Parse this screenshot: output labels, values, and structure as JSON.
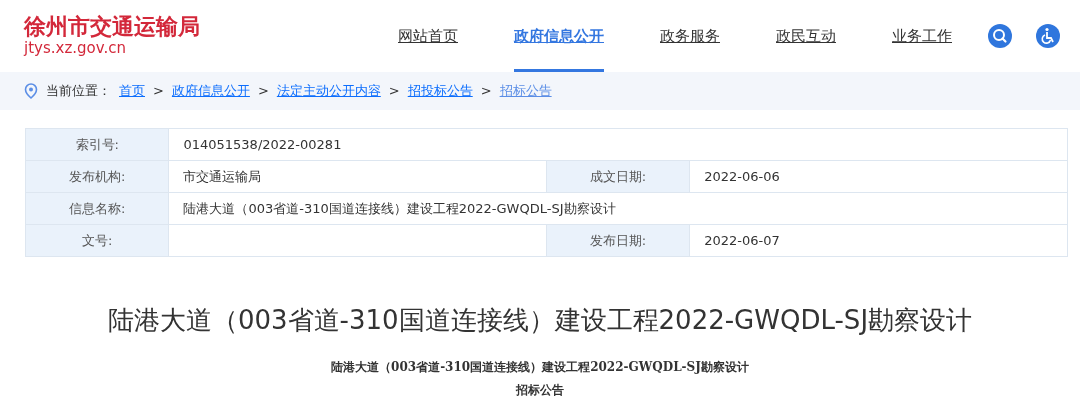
{
  "site": {
    "name": "徐州市交通运输局",
    "domain": "jtys.xz.gov.cn"
  },
  "nav": [
    {
      "label": "网站首页",
      "selected": false
    },
    {
      "label": "政府信息公开",
      "selected": true
    },
    {
      "label": "政务服务",
      "selected": false
    },
    {
      "label": "政民互动",
      "selected": false
    },
    {
      "label": "业务工作",
      "selected": false
    }
  ],
  "breadcrumb": {
    "label": "当前位置：",
    "items": [
      {
        "text": "首页",
        "current": false
      },
      {
        "text": "政府信息公开",
        "current": false
      },
      {
        "text": "法定主动公开内容",
        "current": false
      },
      {
        "text": "招投标公告",
        "current": false
      },
      {
        "text": "招标公告",
        "current": true
      }
    ],
    "separators": [
      ">",
      ">",
      ">",
      ">"
    ]
  },
  "info_table": {
    "rows": [
      {
        "cells": [
          {
            "label": "索引号:",
            "value": "014051538/2022-00281"
          }
        ]
      },
      {
        "cells": [
          {
            "label": "发布机构:",
            "value": "市交通运输局"
          },
          {
            "label": "成文日期:",
            "value": "2022-06-06"
          }
        ]
      },
      {
        "cells": [
          {
            "label": "信息名称:",
            "value": "陆港大道（003省道-310国道连接线）建设工程2022-GWQDL-SJ勘察设计"
          }
        ]
      },
      {
        "cells": [
          {
            "label": "文号:"
          },
          {
            "label": "发布日期:",
            "value": "2022-06-07"
          }
        ]
      }
    ]
  },
  "article": {
    "title": "陆港大道（003省道-310国道连接线）建设工程2022-GWQDL-SJ勘察设计",
    "subtitle_lines": [
      "陆港大道（003省道-310国道连接线）建设工程2022-GWQDL-SJ勘察设计",
      "招标公告"
    ]
  }
}
